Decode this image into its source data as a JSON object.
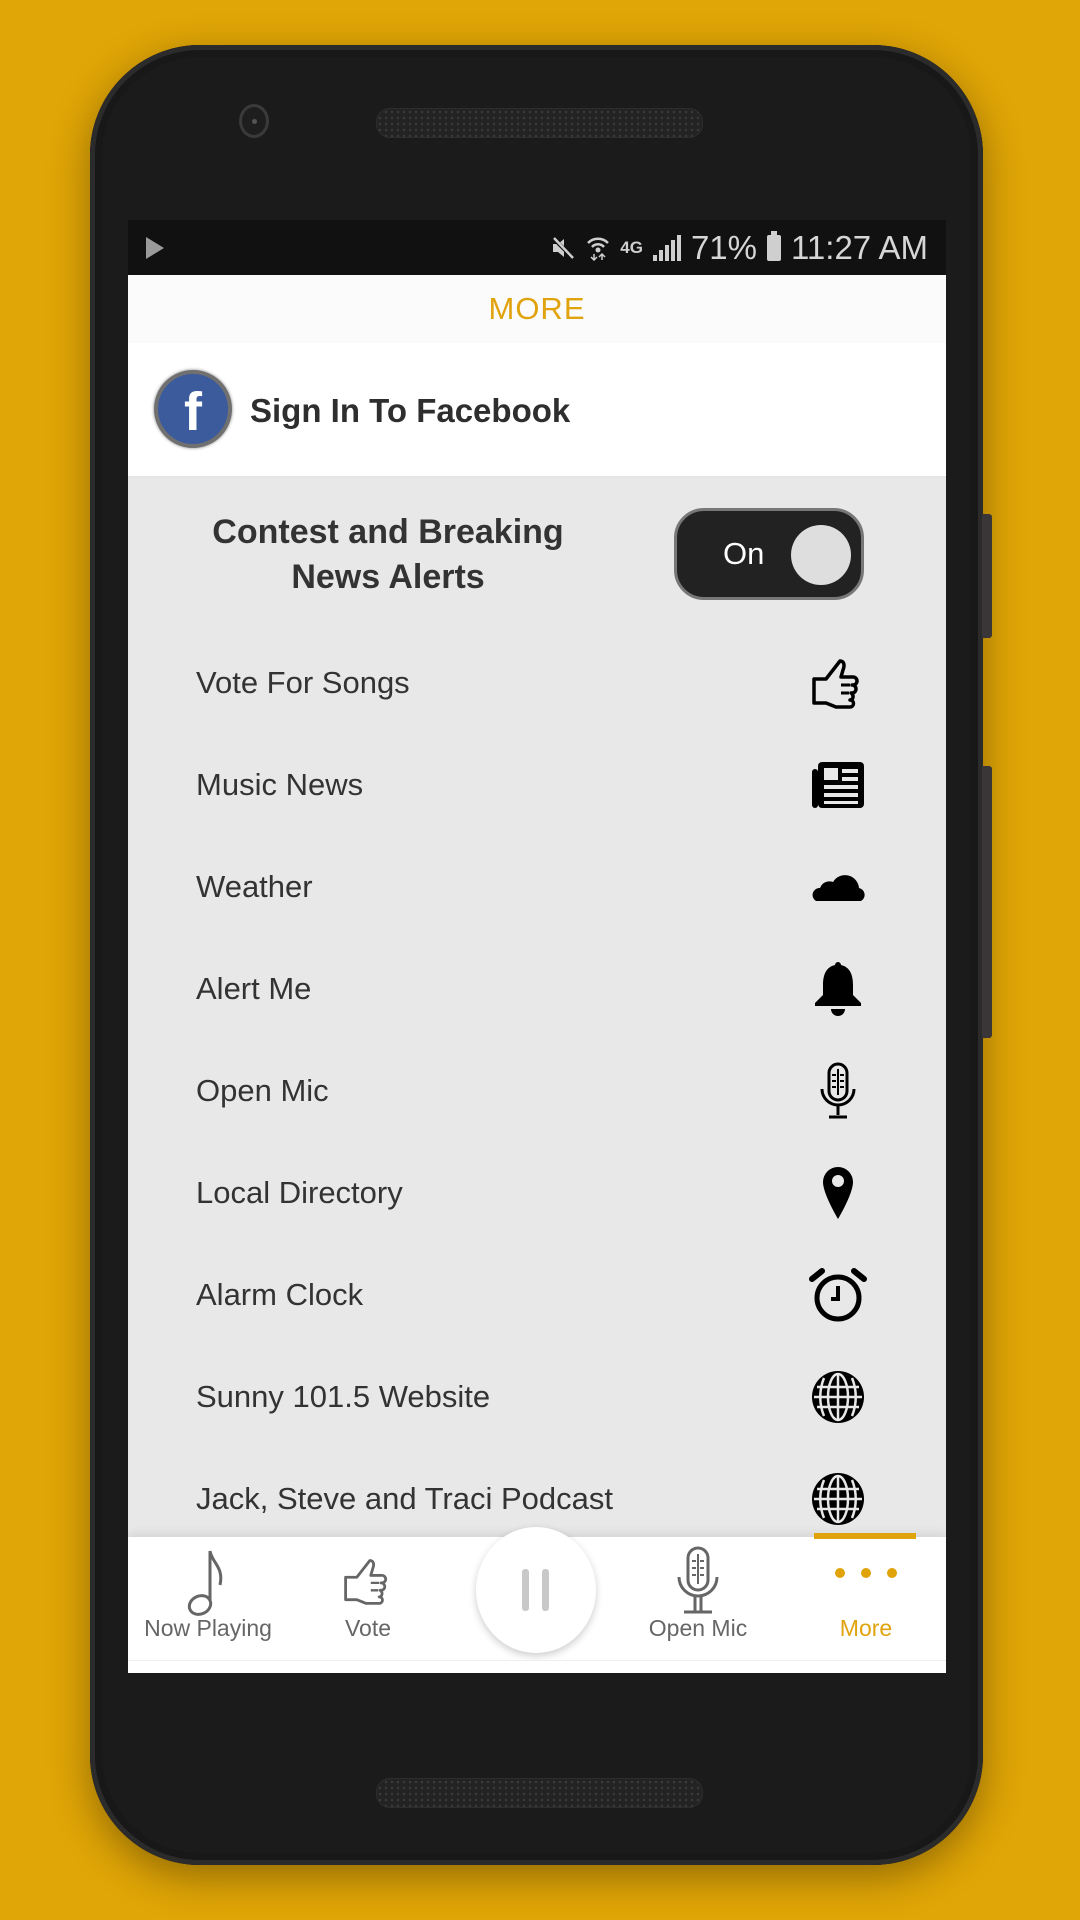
{
  "status_bar": {
    "media_icon": "play-icon",
    "icons": [
      "mute-icon",
      "wifi-icon",
      "4g-lte-icon",
      "signal-icon"
    ],
    "battery": "71%",
    "time": "11:27 AM"
  },
  "header": {
    "title": "MORE"
  },
  "facebook": {
    "icon": "facebook-icon",
    "glyph": "f",
    "label": "Sign In To Facebook"
  },
  "alerts": {
    "label": "Contest and Breaking News Alerts",
    "toggle_label": "On",
    "enabled": true
  },
  "menu": [
    {
      "label": "Vote For Songs",
      "icon": "thumbs-up-icon"
    },
    {
      "label": "Music News",
      "icon": "newspaper-icon"
    },
    {
      "label": "Weather",
      "icon": "cloud-icon"
    },
    {
      "label": "Alert Me",
      "icon": "bell-icon"
    },
    {
      "label": "Open Mic",
      "icon": "microphone-icon"
    },
    {
      "label": "Local Directory",
      "icon": "map-pin-icon"
    },
    {
      "label": "Alarm Clock",
      "icon": "alarm-clock-icon"
    },
    {
      "label": "Sunny 101.5 Website",
      "icon": "globe-icon"
    },
    {
      "label": "Jack, Steve and Traci Podcast",
      "icon": "globe-icon"
    }
  ],
  "bottom_nav": {
    "items": [
      {
        "label": "Now Playing",
        "icon": "music-note-icon"
      },
      {
        "label": "Vote",
        "icon": "thumbs-up-icon"
      },
      {
        "label": "Open Mic",
        "icon": "microphone-icon"
      },
      {
        "label": "More",
        "icon": "more-dots-icon",
        "active": true
      }
    ],
    "center_button": "pause-icon"
  },
  "colors": {
    "accent": "#e0a30c",
    "background": "#e0a506",
    "facebook": "#3b5b9d"
  }
}
